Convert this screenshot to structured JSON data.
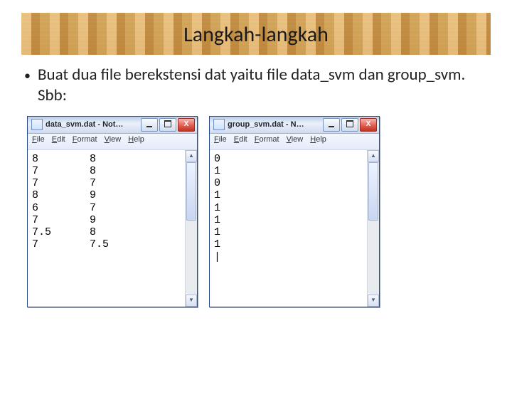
{
  "slide": {
    "heading": "Langkah-langkah",
    "bullet": "Buat dua file berekstensi dat yaitu file data_svm dan group_svm. Sbb:"
  },
  "window_a": {
    "title": "data_svm.dat - Not…",
    "menu": [
      "File",
      "Edit",
      "Format",
      "View",
      "Help"
    ],
    "content": "8        8\n7        8\n7        7\n8        9\n6        7\n7        9\n7.5      8\n7        7.5"
  },
  "window_b": {
    "title": "group_svm.dat - N…",
    "menu": [
      "File",
      "Edit",
      "Format",
      "View",
      "Help"
    ],
    "content": "0\n1\n0\n1\n1\n1\n1\n1\n|"
  }
}
